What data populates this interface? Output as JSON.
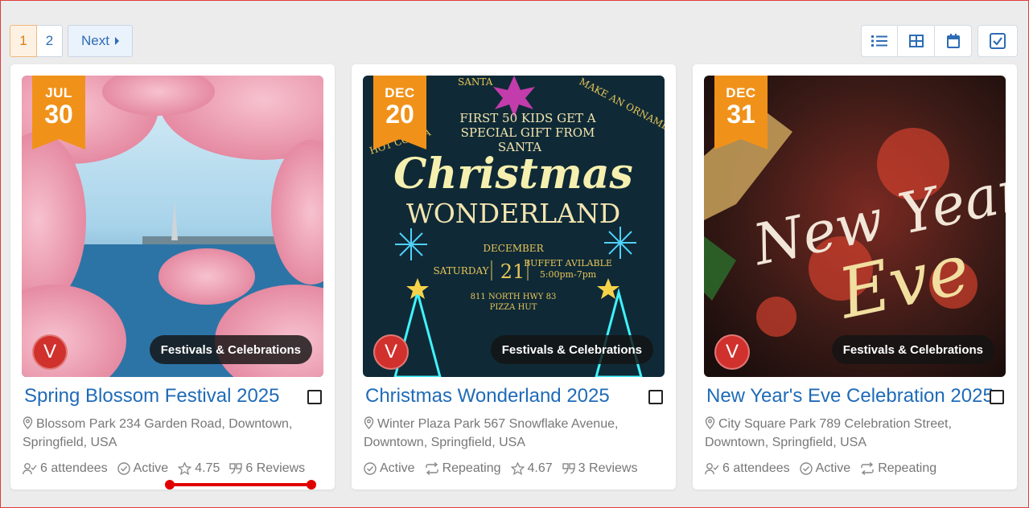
{
  "pagination": {
    "pages": [
      "1",
      "2"
    ],
    "next_label": "Next"
  },
  "views": {
    "icons": [
      "list-view-icon",
      "grid-view-icon",
      "calendar-view-icon",
      "select-all-icon"
    ]
  },
  "cards": [
    {
      "month": "JUL",
      "day": "30",
      "category": "Festivals & Celebrations",
      "avatar": "V",
      "title": "Spring Blossom Festival 2025",
      "address": "Blossom Park 234 Garden Road, Downtown, Springfield, USA",
      "attendees": "6 attendees",
      "status": "Active",
      "rating": "4.75",
      "reviews": "6 Reviews"
    },
    {
      "month": "DEC",
      "day": "20",
      "category": "Festivals & Celebrations",
      "avatar": "V",
      "title": "Christmas Wonderland 2025",
      "address": "Winter Plaza Park 567 Snowflake Avenue, Downtown, Springfield, USA",
      "status": "Active",
      "repeat": "Repeating",
      "rating": "4.67",
      "reviews": "3 Reviews",
      "poster": {
        "top_arc": "SANTA",
        "side_left": "HOT COCOA",
        "side_right": "MAKE AN ORNAMENT",
        "line1": "FIRST 50 KIDS GET A",
        "line2": "SPECIAL GIFT FROM",
        "line3": "SANTA",
        "script": "Christmas",
        "word": "WONDERLAND",
        "month": "DECEMBER",
        "weekday": "SATURDAY",
        "date": "21",
        "buffet": "BUFFET AVILABLE",
        "hours": "5:00pm-7pm",
        "addr1": "811 NORTH HWY 83",
        "addr2": "PIZZA HUT"
      }
    },
    {
      "month": "DEC",
      "day": "31",
      "category": "Festivals & Celebrations",
      "avatar": "V",
      "title": "New Year's Eve Celebration 2025",
      "address": "City Square Park 789 Celebration Street, Downtown, Springfield, USA",
      "attendees": "6 attendees",
      "status": "Active",
      "repeat": "Repeating",
      "poster": {
        "line1": "New Year",
        "line2": "Eve"
      }
    }
  ],
  "colors": {
    "accent": "#f0921a",
    "link": "#1f6bb8",
    "avatar": "#d0312d",
    "annotation": "#e00000"
  }
}
